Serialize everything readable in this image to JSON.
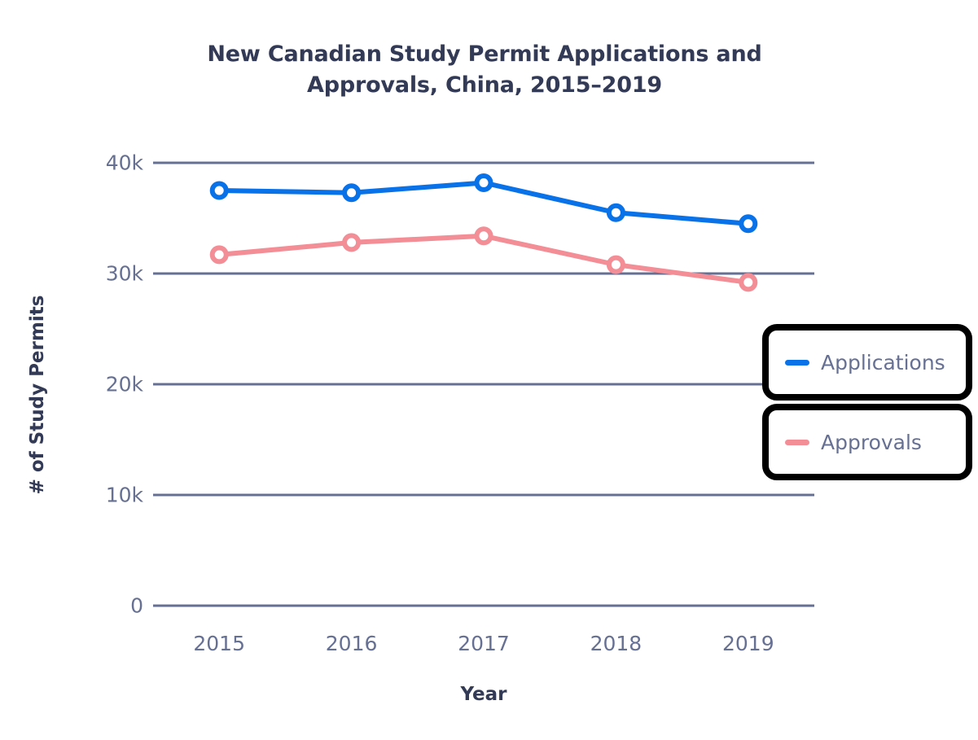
{
  "chart_data": {
    "type": "line",
    "title": "New Canadian Study Permit Applications and Approvals, China, 2015–2019",
    "title_line1": "New Canadian Study Permit Applications and",
    "title_line2": "Approvals, China, 2015–2019",
    "xlabel": "Year",
    "ylabel": "# of Study Permits",
    "categories": [
      "2015",
      "2016",
      "2017",
      "2018",
      "2019"
    ],
    "x": [
      2015,
      2016,
      2017,
      2018,
      2019
    ],
    "series": [
      {
        "name": "Applications",
        "color": "#0a72e8",
        "values": [
          37500,
          37300,
          38200,
          35500,
          34500
        ]
      },
      {
        "name": "Approvals",
        "color": "#f38d96",
        "values": [
          31700,
          32800,
          33400,
          30800,
          29200
        ]
      }
    ],
    "ylim": [
      0,
      42000
    ],
    "y_ticks": [
      0,
      10000,
      20000,
      30000,
      40000
    ],
    "y_tick_labels": [
      "0",
      "10k",
      "20k",
      "30k",
      "40k"
    ],
    "grid": true,
    "grid_color": "#667093",
    "legend_position": "right-middle",
    "marker": "circle-hollow",
    "background": "#ffffff",
    "text_color": "#333a56",
    "tick_color": "#667093"
  },
  "legend": {
    "items": [
      {
        "label": "Applications",
        "color": "#0a72e8"
      },
      {
        "label": "Approvals",
        "color": "#f38d96"
      }
    ]
  }
}
